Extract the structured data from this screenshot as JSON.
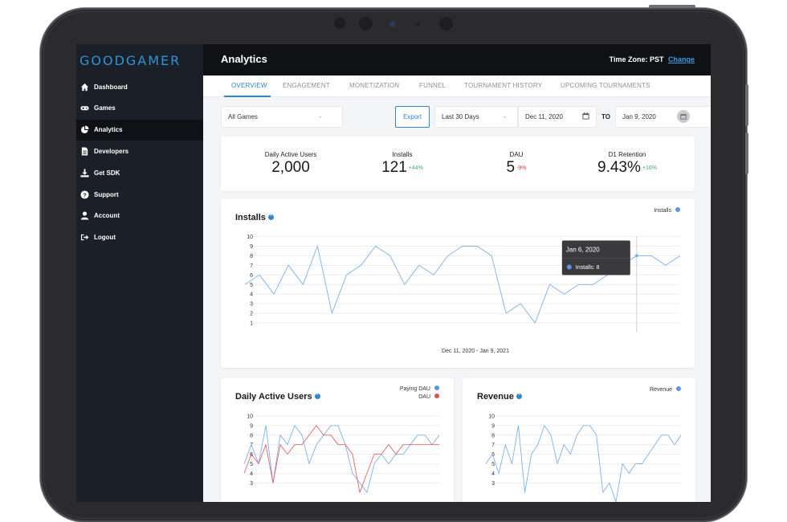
{
  "sidebar": {
    "logo": "GOODGAMER",
    "items": [
      {
        "label": "Dashboard",
        "icon": "home-icon"
      },
      {
        "label": "Games",
        "icon": "gamepad-icon"
      },
      {
        "label": "Analytics",
        "icon": "pie-chart-icon",
        "active": true
      },
      {
        "label": "Developers",
        "icon": "document-icon"
      },
      {
        "label": "Get SDK",
        "icon": "download-icon"
      },
      {
        "label": "Support",
        "icon": "question-icon"
      },
      {
        "label": "Account",
        "icon": "user-icon"
      },
      {
        "label": "Logout",
        "icon": "logout-icon"
      }
    ]
  },
  "header": {
    "title": "Analytics",
    "timezone_label": "Time Zone: PST",
    "change_link": "Change"
  },
  "tabs": [
    "OVERVIEW",
    "ENGAGEMENT",
    "MONETIZATION",
    "FUNNEL",
    "TOURNAMENT HISTORY",
    "UPCOMING TOURNAMENTS"
  ],
  "filters": {
    "game_select": "All Games",
    "game_caret": "-",
    "export_label": "Export",
    "range_select": "Last 30 Days",
    "range_caret": "-",
    "start_date": "Dec 11, 2020",
    "to_label": "TO",
    "end_date": "Jan 9, 2020"
  },
  "kpis": [
    {
      "label": "Daily Active Users",
      "value": "2,000",
      "delta": ""
    },
    {
      "label": "Installs",
      "value": "121",
      "delta": "+44%",
      "trend": "up"
    },
    {
      "label": "DAU",
      "value": "5",
      "delta": "-9%",
      "trend": "down"
    },
    {
      "label": "D1 Retention",
      "value": "9.43%",
      "delta": "+16%",
      "trend": "up"
    }
  ],
  "colors": {
    "accent": "#2f86cc",
    "series_blue": "#7fb0ec",
    "series_red": "#e06565",
    "legend_blue": "#5b93ea",
    "legend_red": "#e05050",
    "up": "#3bb36a",
    "down": "#d53c3c"
  },
  "chart_data": [
    {
      "type": "line",
      "title": "Installs",
      "xlabel": "Dec 11, 2020 - Jan 9, 2021",
      "ylim": [
        0,
        10
      ],
      "yticks": [
        1,
        2,
        3,
        4,
        5,
        6,
        7,
        8,
        9,
        10
      ],
      "legend_placement": "top-right",
      "series": [
        {
          "name": "Installs",
          "values": [
            5,
            6,
            4,
            7,
            5,
            9,
            2,
            6,
            7,
            9,
            8,
            5,
            7,
            6,
            8,
            9,
            9,
            8,
            2,
            3,
            1,
            5,
            4,
            5,
            5,
            6,
            7,
            8,
            8,
            7,
            8
          ]
        }
      ],
      "tooltip": {
        "date": "Jan 6, 2020",
        "text": "Installs: 8",
        "index": 27
      }
    },
    {
      "type": "line",
      "title": "Daily Active Users",
      "ylim": [
        0,
        10
      ],
      "yticks": [
        3,
        4,
        5,
        6,
        7,
        8,
        9,
        10
      ],
      "legend_placement": "top-right",
      "series": [
        {
          "name": "Paying DAU",
          "values": [
            5,
            7,
            5,
            9,
            3,
            8,
            7,
            9,
            8,
            5,
            7,
            8,
            9,
            9,
            7,
            4,
            3,
            2,
            5,
            6,
            5,
            6,
            6,
            7,
            8,
            8,
            7,
            8
          ]
        },
        {
          "name": "DAU",
          "values": [
            4,
            6,
            5,
            7,
            3,
            7,
            6,
            7,
            7,
            8,
            9,
            8,
            8,
            7,
            7,
            6,
            2,
            4,
            6,
            6,
            7,
            6,
            7,
            7,
            7,
            7,
            7,
            7
          ]
        }
      ]
    },
    {
      "type": "line",
      "title": "Revenue",
      "ylim": [
        0,
        10
      ],
      "yticks": [
        3,
        4,
        5,
        6,
        7,
        8,
        9,
        10
      ],
      "legend_placement": "top-right",
      "series": [
        {
          "name": "Revenue",
          "values": [
            5,
            6,
            4,
            7,
            5,
            9,
            2,
            6,
            7,
            9,
            8,
            5,
            7,
            6,
            8,
            9,
            9,
            8,
            2,
            3,
            1,
            5,
            4,
            5,
            5,
            6,
            7,
            8,
            8,
            7,
            8
          ]
        }
      ]
    }
  ]
}
